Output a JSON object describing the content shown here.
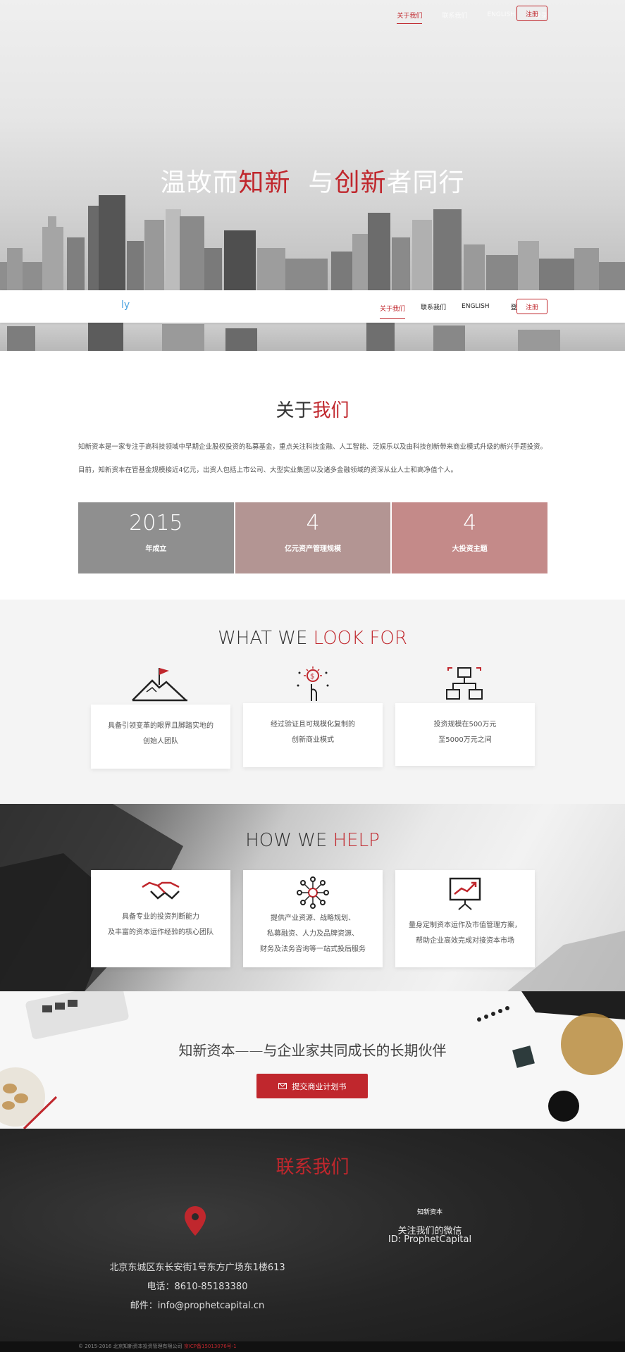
{
  "topnav": {
    "items": [
      "关于我们",
      "联系我们",
      "ENGLISH"
    ],
    "login": "登录",
    "register": "注册"
  },
  "hero": {
    "t1": "温故而",
    "t2": "知新",
    "t3": "与",
    "t4": "创新",
    "t5": "者同行"
  },
  "sticky": {
    "logo": "ly",
    "items": [
      "关于我们",
      "联系我们",
      "ENGLISH"
    ],
    "login": "登录",
    "register": "注册"
  },
  "about": {
    "title_a": "关于",
    "title_b": "我们",
    "p1": "知新资本是一家专注于高科技领域中早期企业股权投资的私募基金，重点关注科技金融、人工智能、泛娱乐以及由科技创新带来商业模式升级的新兴手题投资。",
    "p2": "目前，知新资本在管基金规模接近4亿元，出资人包括上市公司、大型实业集团以及诸多金融领域的资深从业人士和高净值个人。",
    "stats": [
      {
        "num": "2015",
        "label": "年成立",
        "color": "#8f8f8f"
      },
      {
        "num": "4",
        "label": "亿元资产管理规模",
        "color": "#b39593"
      },
      {
        "num": "4",
        "label": "大投资主题",
        "color": "#c48a89"
      }
    ]
  },
  "lookfor": {
    "title_a": "WHAT WE ",
    "title_b": "LOOK FOR",
    "cards": [
      {
        "icon": "mountain-flag-icon",
        "l1": "具备引领变革的眼界且脚踏实地的",
        "l2": "创始人团队"
      },
      {
        "icon": "lightbulb-hand-icon",
        "l1": "经过验证且可规模化复制的",
        "l2": "创新商业模式"
      },
      {
        "icon": "network-computers-icon",
        "l1": "投资规模在500万元",
        "l2": "至5000万元之间"
      }
    ]
  },
  "help": {
    "title_a": "HOW WE ",
    "title_b": "HELP",
    "cards": [
      {
        "icon": "handshake-icon",
        "lines": [
          "具备专业的投资判断能力",
          "及丰富的资本运作经验的核心团队"
        ]
      },
      {
        "icon": "resource-network-icon",
        "lines": [
          "提供产业资源、战略规划、",
          "私募融资、人力及品牌资源、",
          "财务及法务咨询等一站式投后服务"
        ]
      },
      {
        "icon": "presentation-chart-icon",
        "lines": [
          "量身定制资本运作及市值管理方案，",
          "帮助企业高效完成对接资本市场"
        ]
      }
    ]
  },
  "partner": {
    "title": "知新资本——与企业家共同成长的长期伙伴",
    "button": "提交商业计划书",
    "button_icon": "envelope-icon"
  },
  "contact": {
    "title": "联系我们",
    "address": "北京东城区东长安街1号东方广场东1楼613",
    "phone": "电话：8610-85183380",
    "email": "邮件：info@prophetcapital.cn",
    "wx_brand": "知新资本",
    "wx_follow": "关注我们的微信",
    "wx_id": "ID: ProphetCapital"
  },
  "footer": {
    "copy": "© 2015-2016 北京知新资本投资管理有限公司 ",
    "icp": "京ICP备15013076号-1"
  },
  "colors": {
    "accent": "#c0272d",
    "dark": "#1f1f1f",
    "light": "#f4f4f4"
  }
}
